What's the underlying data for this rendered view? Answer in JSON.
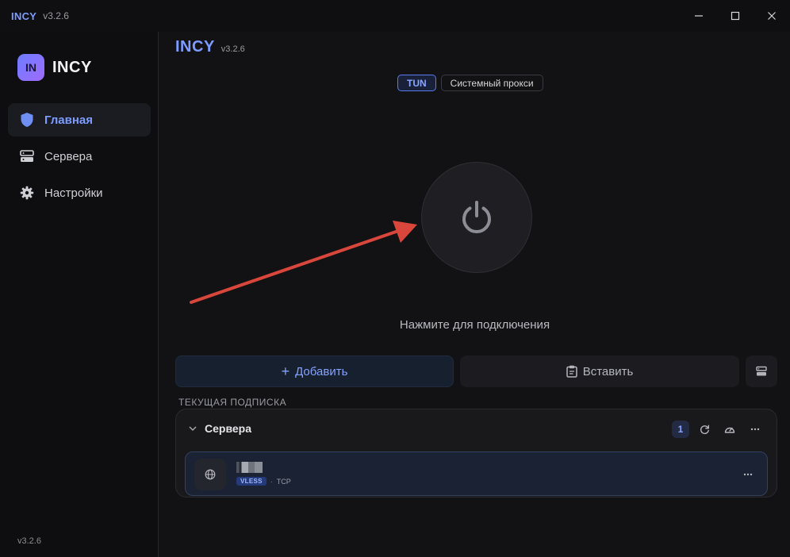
{
  "window": {
    "app_name": "INCY",
    "version": "v3.2.6"
  },
  "sidebar": {
    "brand_logo": "IN",
    "brand_name": "INCY",
    "items": [
      {
        "label": "Главная",
        "icon": "shield-icon",
        "active": true
      },
      {
        "label": "Сервера",
        "icon": "server-icon",
        "active": false
      },
      {
        "label": "Настройки",
        "icon": "gear-icon",
        "active": false
      }
    ],
    "version": "v3.2.6"
  },
  "main": {
    "title": "INCY",
    "version": "v3.2.6",
    "modes": [
      {
        "label": "TUN",
        "active": true
      },
      {
        "label": "Системный прокси",
        "active": false
      }
    ],
    "power_icon": "power-icon",
    "connect_hint": "Нажмите для подключения",
    "add_label": "Добавить",
    "paste_label": "Вставить",
    "subscription_label": "ТЕКУЩАЯ ПОДПИСКА",
    "group": {
      "name": "Сервера",
      "count": "1"
    },
    "server": {
      "protocol": "VLESS",
      "separator": "·",
      "transport": "TCP"
    }
  },
  "colors": {
    "accent": "#7c9cff",
    "background": "#121214",
    "sidebar": "#0e0e10",
    "annotation_arrow": "#d9463b"
  }
}
